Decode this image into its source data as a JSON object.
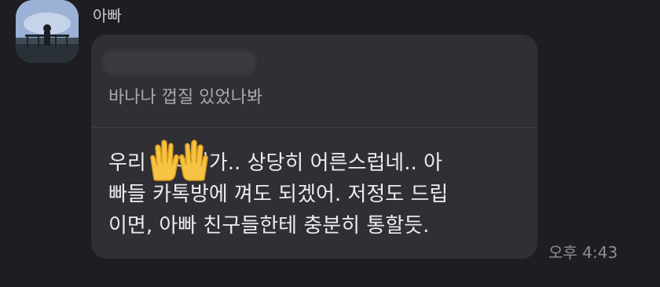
{
  "sender": {
    "name": "아빠"
  },
  "message": {
    "reply_quote_text": "바나나 껍질 있었나봐",
    "body_lines": [
      "우리 ㅇㅇ이가.. 상당히 어른스럽네.. 아",
      "빠들 카톡방에 껴도 되겠어. 저정도 드립",
      "이면, 아빠 친구들한테 충분히 통할듯."
    ],
    "time": "오후 4:43"
  },
  "colors": {
    "background": "#1e1e22",
    "bubble": "#2f2f34",
    "text": "#ececef",
    "muted_text": "#a9a9ae",
    "emoji": "#f6c343"
  },
  "icons": {
    "avatar": "profile-photo",
    "overlay": "raised-hands-emoji"
  }
}
